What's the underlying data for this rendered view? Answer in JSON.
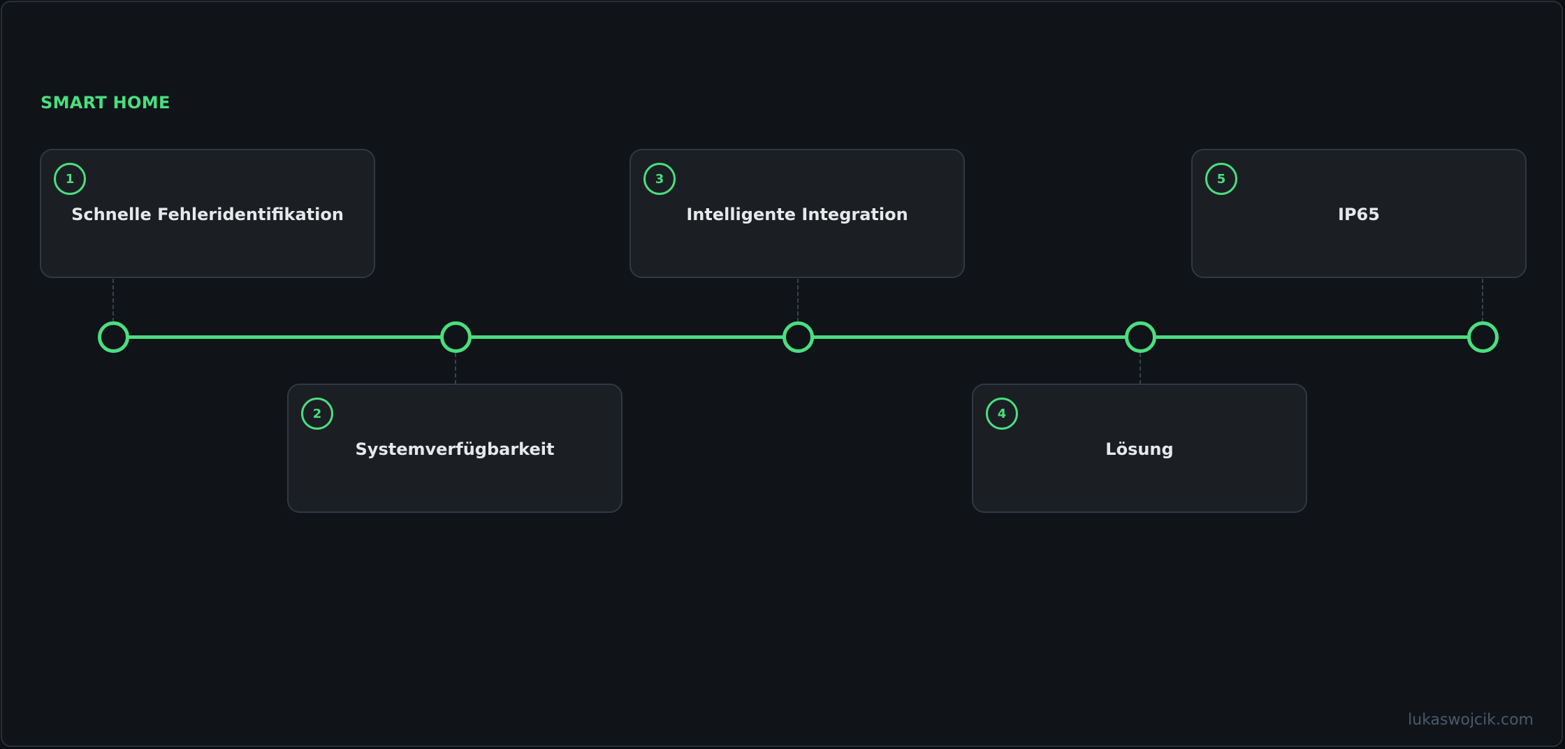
{
  "heading": "SMART HOME",
  "colors": {
    "accent": "#4ade80",
    "background": "#101418",
    "card": "#1b1f23",
    "card_border": "#313844",
    "text": "#e6e8ea",
    "watermark": "#4a5a6e"
  },
  "steps": [
    {
      "number": "1",
      "title": "Schnelle Fehleridentifikation",
      "position": "above"
    },
    {
      "number": "2",
      "title": "Systemverfügbarkeit",
      "position": "below"
    },
    {
      "number": "3",
      "title": "Intelligente Integration",
      "position": "above"
    },
    {
      "number": "4",
      "title": "Lösung",
      "position": "below"
    },
    {
      "number": "5",
      "title": "IP65",
      "position": "above"
    }
  ],
  "watermark": "lukaswojcik.com"
}
